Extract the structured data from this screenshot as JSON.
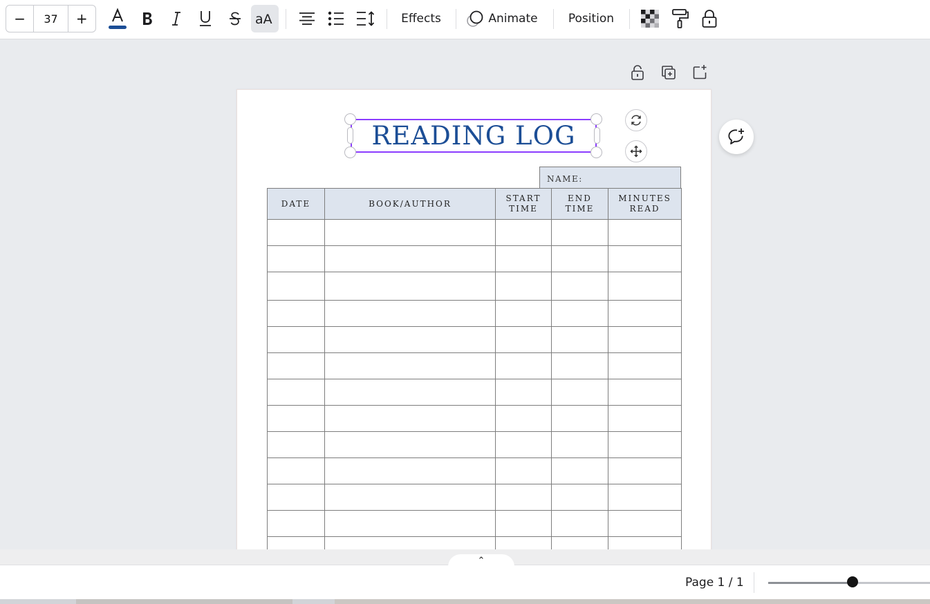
{
  "toolbar": {
    "font_size": {
      "decrease_label": "−",
      "value": "37",
      "increase_label": "+"
    },
    "text_color": "#1c4e96",
    "effects_label": "Effects",
    "animate_label": "Animate",
    "position_label": "Position"
  },
  "document": {
    "title": "READING LOG",
    "name_label": "NAME:",
    "columns": [
      {
        "line1": "DATE",
        "line2": ""
      },
      {
        "line1": "BOOK/AUTHOR",
        "line2": ""
      },
      {
        "line1": "START",
        "line2": "TIME"
      },
      {
        "line1": "END",
        "line2": "TIME"
      },
      {
        "line1": "MINUTES",
        "line2": "READ"
      }
    ],
    "visible_rows": 13
  },
  "footer": {
    "page_label": "Page 1 / 1",
    "expand_glyph": "⌃",
    "zoom_fraction": 0.52
  },
  "colors": {
    "selection": "#8b3dff",
    "title_text": "#1c4e96",
    "header_fill": "#dde4ee",
    "active_tool_bg": "#e4e6ea"
  }
}
